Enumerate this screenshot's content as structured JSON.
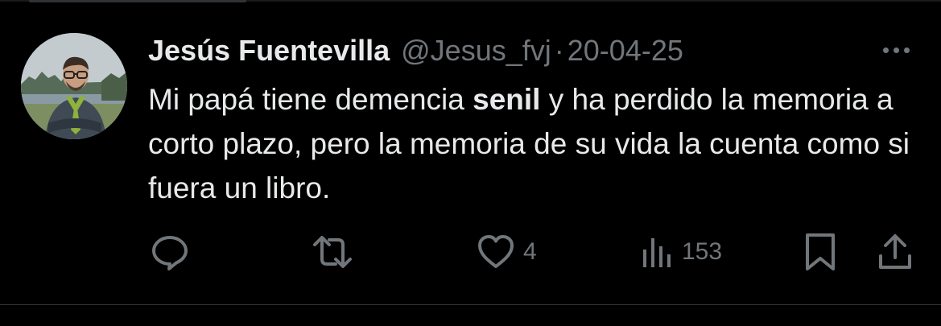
{
  "tweet": {
    "author": {
      "display_name": "Jesús Fuentevilla",
      "handle": "@Jesus_fvj"
    },
    "separator": "·",
    "date": "20-04-25",
    "text": {
      "before": "Mi papá tiene demencia ",
      "highlight": "senil",
      "after": " y ha perdido la memoria a corto plazo, pero la memoria de su vida la cuenta como si fuera un libro."
    },
    "metrics": {
      "likes": "4",
      "views": "153"
    },
    "icons": {
      "more": "more-horizontal-icon",
      "reply": "reply-icon",
      "retweet": "retweet-icon",
      "like": "heart-icon",
      "views": "views-chart-icon",
      "bookmark": "bookmark-icon",
      "share": "share-icon"
    },
    "colors": {
      "background": "#000000",
      "primary_text": "#e7e9ea",
      "secondary_text": "#71767b",
      "divider": "#2f3336"
    }
  }
}
